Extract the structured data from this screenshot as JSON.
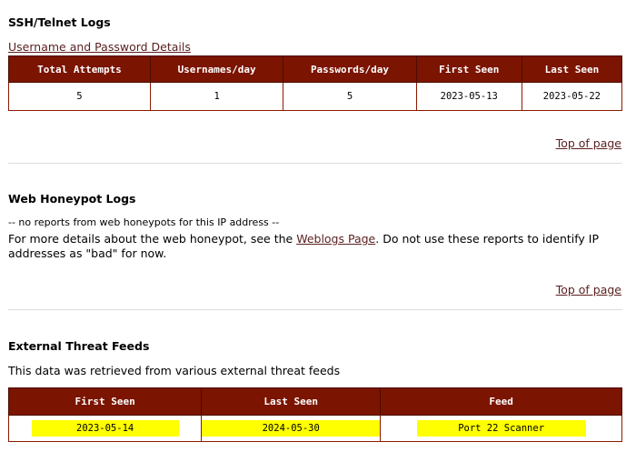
{
  "ssh": {
    "title": "SSH/Telnet Logs",
    "details_link": "Username and Password Details",
    "headers": [
      "Total Attempts",
      "Usernames/day",
      "Passwords/day",
      "First Seen",
      "Last Seen"
    ],
    "row": [
      "5",
      "1",
      "5",
      "2023-05-13",
      "2023-05-22"
    ],
    "top_link": "Top of page"
  },
  "web": {
    "title": "Web Honeypot Logs",
    "no_reports": "-- no reports from web honeypots for this IP address --",
    "details_prefix": "For more details about the web honeypot, see the ",
    "weblogs_link": "Weblogs Page",
    "details_suffix": ". Do not use these reports to identify IP addresses as \"bad\" for now.",
    "top_link": "Top of page"
  },
  "feeds": {
    "title": "External Threat Feeds",
    "description": "This data was retrieved from various external threat feeds",
    "headers": [
      "First Seen",
      "Last Seen",
      "Feed"
    ],
    "row": [
      "2023-05-14",
      "2024-05-30",
      "Port 22 Scanner"
    ],
    "highlight_color": "#ffff00"
  },
  "colors": {
    "header_bg": "#7b1400",
    "link": "#5a1f1f"
  }
}
